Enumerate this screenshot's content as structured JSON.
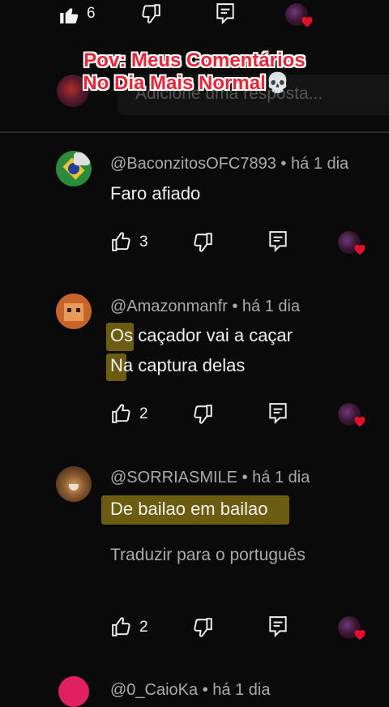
{
  "top_bar": {
    "like_count": "6"
  },
  "overlay": {
    "line1": "Pov: Meus Comentários",
    "line2": "No Dia Mais Normal",
    "emoji": "💀"
  },
  "reply_box": {
    "placeholder": "Adicione uma resposta..."
  },
  "comments": [
    {
      "author": "@BaconzitosOFC7893",
      "time": "há 1 dia",
      "lines": [
        "Faro afiado"
      ],
      "likes": "3"
    },
    {
      "author": "@Amazonmanfr",
      "time": "há 1 dia",
      "lines": [
        "Os caçador vai a caçar",
        "Na captura delas"
      ],
      "likes": "2"
    },
    {
      "author": "@SORRIASMILE",
      "time": "há 1 dia",
      "lines": [
        "De bailao em bailao"
      ],
      "translate": "Traduzir para o português",
      "likes": "2"
    },
    {
      "author": "@0_CaioKa",
      "time": "há 1 dia"
    }
  ],
  "colors": {
    "background": "#0a0a0a",
    "text": "#f1f1f1",
    "meta": "#aaaaaa",
    "overlay_red": "#e8263a",
    "heart": "#e0102a",
    "highlight": "#bea014"
  },
  "icons": [
    "thumbs-up-icon",
    "thumbs-down-icon",
    "reply-icon",
    "creator-heart-icon"
  ]
}
